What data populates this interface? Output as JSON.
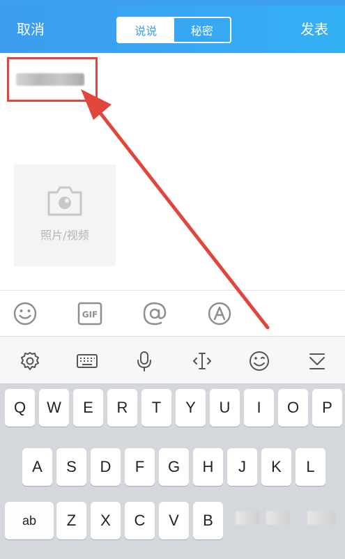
{
  "header": {
    "cancel_label": "取消",
    "publish_label": "发表",
    "tabs": [
      {
        "label": "说说",
        "active": true
      },
      {
        "label": "秘密",
        "active": false
      }
    ]
  },
  "compose": {
    "photo_label": "照片/视频"
  },
  "toolbar": {
    "items": [
      "smiley-icon",
      "gif-icon",
      "at-icon",
      "font-style-icon"
    ],
    "gif_text": "GIF"
  },
  "keyboard_toolbar": {
    "items": [
      "gear-icon",
      "keyboard-icon",
      "microphone-icon",
      "cursor-icon",
      "emoji-icon",
      "collapse-keyboard-icon"
    ]
  },
  "keyboard": {
    "row1": [
      "Q",
      "W",
      "E",
      "R",
      "T",
      "Y",
      "U",
      "I",
      "O",
      "P"
    ],
    "row2": [
      "A",
      "S",
      "D",
      "F",
      "G",
      "H",
      "J",
      "K",
      "L"
    ],
    "row3_func": "ab",
    "row3": [
      "Z",
      "X",
      "C",
      "V",
      "B"
    ]
  },
  "colors": {
    "header_blue": "#3a9cf2",
    "annotation_red": "#e0463c",
    "keyboard_bg": "#d4d7dc"
  }
}
